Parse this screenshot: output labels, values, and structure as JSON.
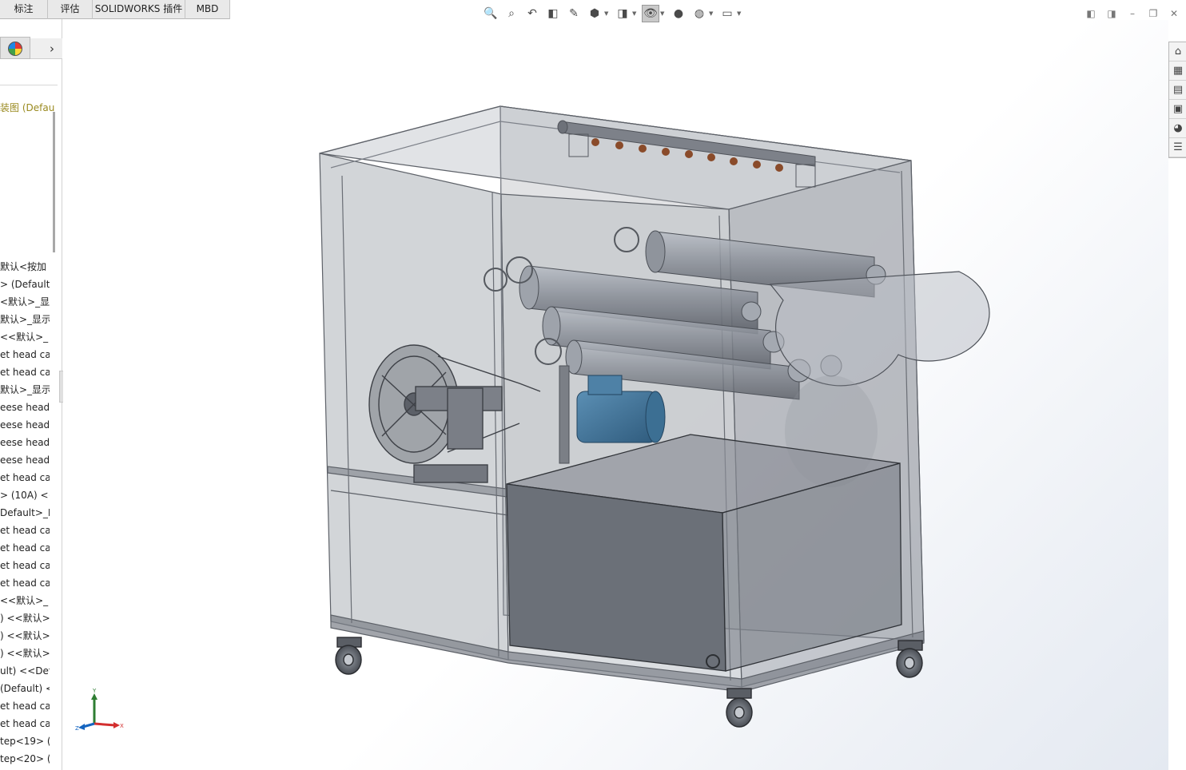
{
  "tabs": [
    "标注",
    "评估",
    "SOLIDWORKS 插件",
    "MBD"
  ],
  "tree": {
    "title": "装图 (Defau",
    "items": [
      "默认<按加",
      "> (Default)",
      "<默认>_显",
      "默认>_显示",
      "<<默认>_",
      "et head ca",
      "et head ca",
      "默认>_显示",
      "eese head",
      "eese head",
      "eese head",
      "eese head",
      "et head ca",
      "> (10A) <<",
      "Default>_D",
      "et head ca",
      "et head ca",
      "et head ca",
      "et head ca",
      "<<默认>_",
      ") <<默认>",
      ") <<默认>",
      ") <<默认>",
      "ult) <<Def",
      "(Default) <",
      "et head ca",
      "et head ca",
      "tep<19> (",
      "tep<20> ("
    ]
  },
  "hud_icons": [
    "zoom-to-fit-icon",
    "zoom-area-icon",
    "previous-view-icon",
    "section-view-icon",
    "dynamic-annotation-icon",
    "view-orientation-icon",
    "display-style-icon",
    "hide-show-items-icon",
    "edit-appearance-icon",
    "apply-scene-icon",
    "view-settings-icon"
  ],
  "window_controls": [
    "tile-left",
    "tile-right",
    "minimize",
    "restore",
    "close"
  ],
  "taskpane_icons": [
    "home-icon",
    "parts-library-icon",
    "file-explorer-icon",
    "view-palette-icon",
    "appearances-icon",
    "custom-properties-icon"
  ],
  "triad": {
    "x": "X",
    "y": "Y",
    "z": "Z"
  },
  "colors": {
    "accent_yellow": "#9a8a20",
    "axis_x": "#d32f2f",
    "axis_y": "#2e7d32",
    "axis_z": "#1565c0"
  }
}
